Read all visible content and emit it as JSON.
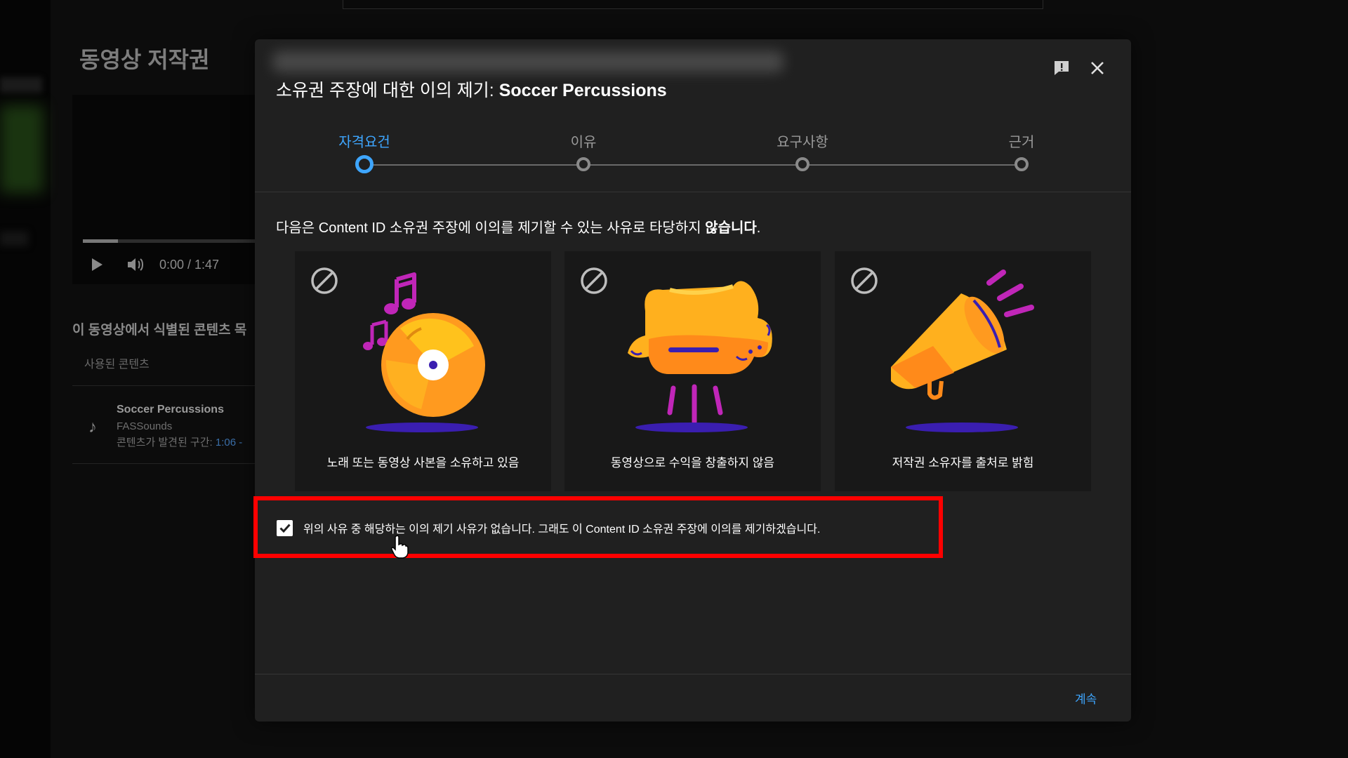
{
  "background": {
    "page_title": "동영상 저작권",
    "player": {
      "time": "0:00 / 1:47",
      "progress": 0.2
    },
    "section_title": "이 동영상에서 식별된 콘텐츠 목",
    "used_content_label": "사용된 콘텐츠",
    "content_item": {
      "title": "Soccer Percussions",
      "artist": "FASSounds",
      "found_label": "콘텐츠가 발견된 구간:",
      "found_time": "1:06 -",
      "icon": "music-note-icon"
    }
  },
  "dialog": {
    "title_prefix": "소유권 주장에 대한 이의 제기: ",
    "title_name": "Soccer Percussions",
    "steps": [
      {
        "label": "자격요건",
        "active": true
      },
      {
        "label": "이유",
        "active": false
      },
      {
        "label": "요구사항",
        "active": false
      },
      {
        "label": "근거",
        "active": false
      }
    ],
    "intro_prefix": "다음은 Content ID 소유권 주장에 이의를 제기할 수 있는 사유로 타당하지 ",
    "intro_bold": "않습니다",
    "intro_suffix": ".",
    "cards": [
      {
        "caption": "노래 또는 동영상 사본을 소유하고 있음",
        "icon": "vinyl-record-icon"
      },
      {
        "caption": "동영상으로 수익을 창출하지 않음",
        "icon": "piggy-bank-icon"
      },
      {
        "caption": "저작권 소유자를 출처로 밝힘",
        "icon": "megaphone-icon"
      }
    ],
    "checkbox": {
      "checked": true,
      "label": "위의 사유 중 해당하는 이의 제기 사유가 없습니다. 그래도 이 Content ID 소유권 주장에 이의를 제기하겠습니다."
    },
    "continue_label": "계속"
  },
  "colors": {
    "accent": "#3ea6ff",
    "dialog_bg": "#202020",
    "card_bg": "#181818",
    "highlight": "#ff0000"
  }
}
